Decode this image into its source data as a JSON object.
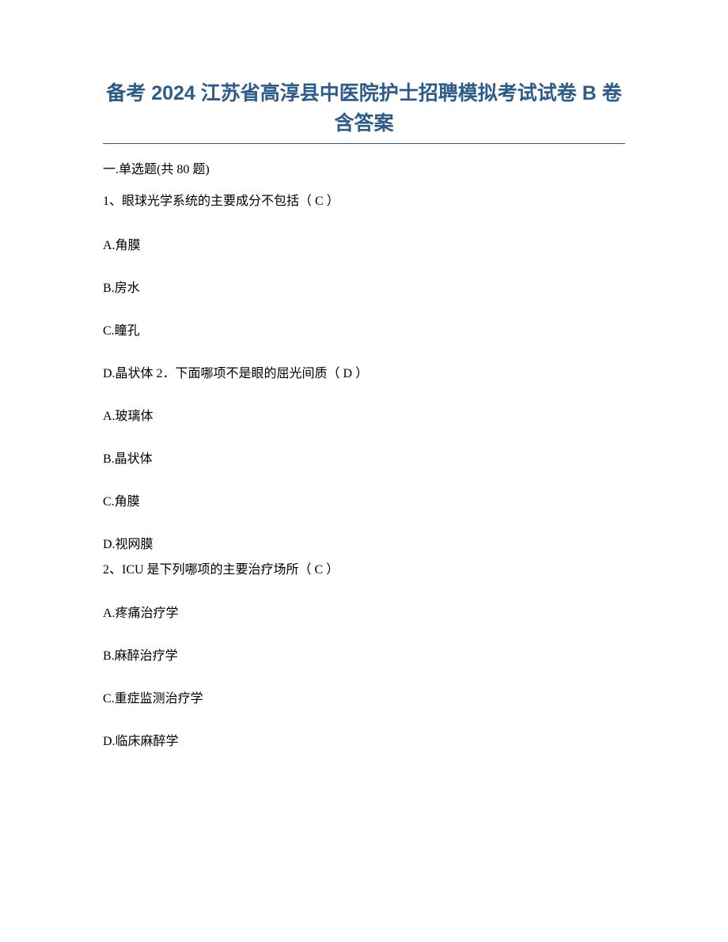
{
  "title_line1": "备考 2024 江苏省高淳县中医院护士招聘模拟考试试卷 B 卷",
  "title_line2": "含答案",
  "section": "一.单选题(共 80 题)",
  "q1": {
    "stem": "1、眼球光学系统的主要成分不包括（ C ）",
    "A": "A.角膜",
    "B": "B.房水",
    "C": "C.瞳孔",
    "D": "D.晶状体  2．下面哪项不是眼的屈光间质（ D ）",
    "q2b_A": "A.玻璃体",
    "q2b_B": "B.晶状体",
    "q2b_C": "C.角膜",
    "q2b_D": "D.视网膜"
  },
  "q2": {
    "stem": "2、ICU 是下列哪项的主要治疗场所（ C ）",
    "A": "A.疼痛治疗学",
    "B": "B.麻醉治疗学",
    "C": "C.重症监测治疗学",
    "D": "D.临床麻醉学"
  }
}
